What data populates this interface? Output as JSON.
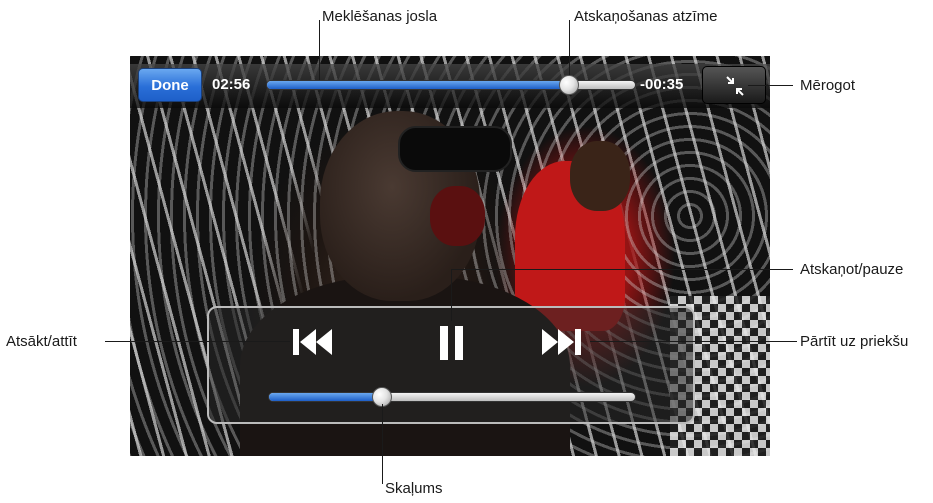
{
  "player": {
    "done_label": "Done",
    "elapsed_time": "02:56",
    "remaining_time": "-00:35",
    "scrub_progress": 0.82,
    "volume_level": 0.31
  },
  "callouts": {
    "scrubber_bar": "Meklēšanas josla",
    "playhead": "Atskaņošanas atzīme",
    "scale": "Mērogot",
    "play_pause": "Atskaņot/pauze",
    "restart_rewind": "Atsākt/attīt",
    "fast_forward": "Pārtīt uz priekšu",
    "volume": "Skaļums"
  },
  "icons": {
    "scale": "scale-icon",
    "previous": "skip-back-icon",
    "pause": "pause-icon",
    "next": "skip-forward-icon"
  },
  "colors": {
    "accent_blue": "#2a6fd8",
    "bar_gray": "#3a3a3a"
  }
}
